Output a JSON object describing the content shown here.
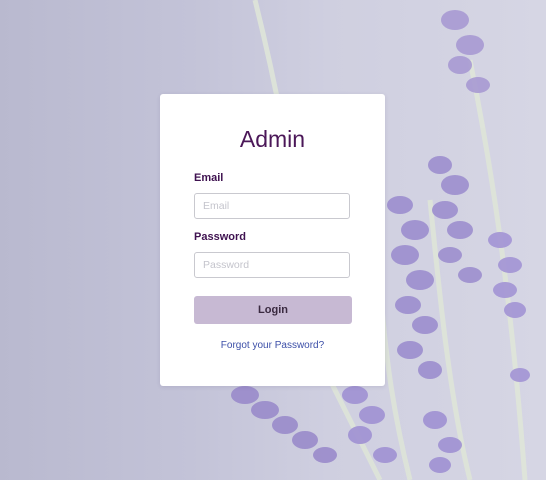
{
  "login": {
    "title": "Admin",
    "email_label": "Email",
    "email_placeholder": "Email",
    "email_value": "",
    "password_label": "Password",
    "password_placeholder": "Password",
    "password_value": "",
    "login_button": "Login",
    "forgot_link": "Forgot your Password?"
  },
  "colors": {
    "title": "#4b1758",
    "button_bg": "#c7b9d3",
    "link": "#3c4fa8",
    "background": "#c3c3d8"
  }
}
